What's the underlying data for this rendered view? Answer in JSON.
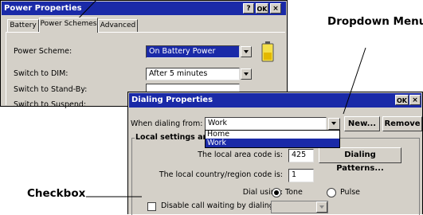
{
  "power_window": {
    "title": "Power Properties",
    "title_buttons": [
      "?",
      "OK",
      "×"
    ],
    "tabs": [
      "Battery",
      "Power Schemes",
      "Advanced"
    ],
    "rows": [
      {
        "label": "Power Scheme:",
        "value": "On Battery Power"
      },
      {
        "label": "Switch to DIM:",
        "value": "After 5 minutes"
      },
      {
        "label": "Switch to Stand-By:",
        "value": ""
      },
      {
        "label": "Switch to Suspend:",
        "value": ""
      }
    ]
  },
  "dialing_window": {
    "title": "Dialing Properties",
    "title_buttons": [
      "OK",
      "×"
    ],
    "when_dialing_label": "When dialing from:",
    "when_dialing_value": "Work",
    "dropdown_options": [
      "Home",
      "Work"
    ],
    "new_button": "New...",
    "remove_button": "Remove",
    "group_label": "Local settings are",
    "area_code_label": "The local area code is:",
    "area_code_value": "425",
    "dialing_patterns_button": "Dialing Patterns...",
    "country_code_label": "The local country/region code is:",
    "country_code_value": "1",
    "dial_using_label": "Dial using:",
    "tone_label": "Tone",
    "pulse_label": "Pulse",
    "disable_call_waiting_label": "Disable call waiting by dialing:"
  },
  "callouts": {
    "dropdown_menu": "Dropdown Menu",
    "checkbox": "Checkbox"
  }
}
